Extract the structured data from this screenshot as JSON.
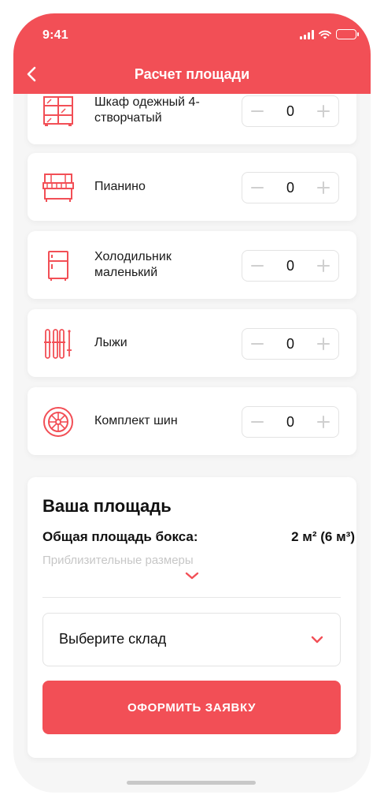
{
  "status": {
    "time": "9:41"
  },
  "header": {
    "title": "Расчет площади",
    "back_icon": "chevron-left-icon"
  },
  "items": [
    {
      "label": "Шкаф одежный 4-створчатый",
      "quantity": "0",
      "icon": "wardrobe-icon"
    },
    {
      "label": "Пианино",
      "quantity": "0",
      "icon": "piano-icon"
    },
    {
      "label": "Холодильник маленький",
      "quantity": "0",
      "icon": "fridge-icon"
    },
    {
      "label": "Лыжи",
      "quantity": "0",
      "icon": "skis-icon"
    },
    {
      "label": "Комплект шин",
      "quantity": "0",
      "icon": "tire-icon"
    }
  ],
  "summary": {
    "title": "Ваша площадь",
    "total_label": "Общая площадь бокса:",
    "total_value": "2 м² (6 м³)",
    "hint": "Приблизительные размеры",
    "warehouse_placeholder": "Выберите склад",
    "submit_label": "ОФОРМИТЬ ЗАЯВКУ"
  },
  "colors": {
    "accent": "#f24f56",
    "background": "#f6f6f6",
    "card": "#ffffff"
  }
}
